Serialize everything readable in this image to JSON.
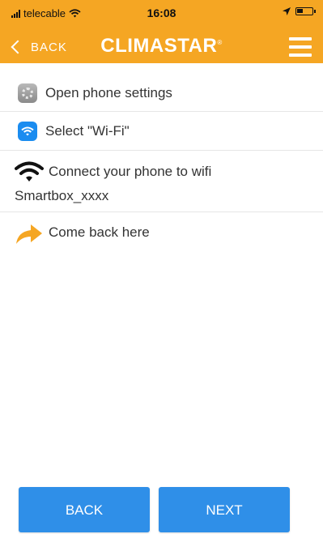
{
  "status_bar": {
    "carrier": "telecable",
    "time": "16:08"
  },
  "header": {
    "back_label": "BACK",
    "brand": "CLIMASTAR",
    "brand_mark": "®",
    "menu_icon": "hamburger-menu-icon"
  },
  "steps": [
    {
      "icon": "settings-gear-icon",
      "text": "Open phone settings"
    },
    {
      "icon": "wifi-app-icon",
      "text": "Select \"Wi-Fi\""
    },
    {
      "icon": "wifi-icon",
      "text": "Connect your phone to wifi",
      "text_line2": "Smartbox_xxxx"
    },
    {
      "icon": "arrow-right-icon",
      "text": "Come back here"
    }
  ],
  "buttons": {
    "back": "BACK",
    "next": "NEXT"
  },
  "colors": {
    "header": "#f5a623",
    "button": "#2f8fe8",
    "arrow": "#f5a623"
  }
}
